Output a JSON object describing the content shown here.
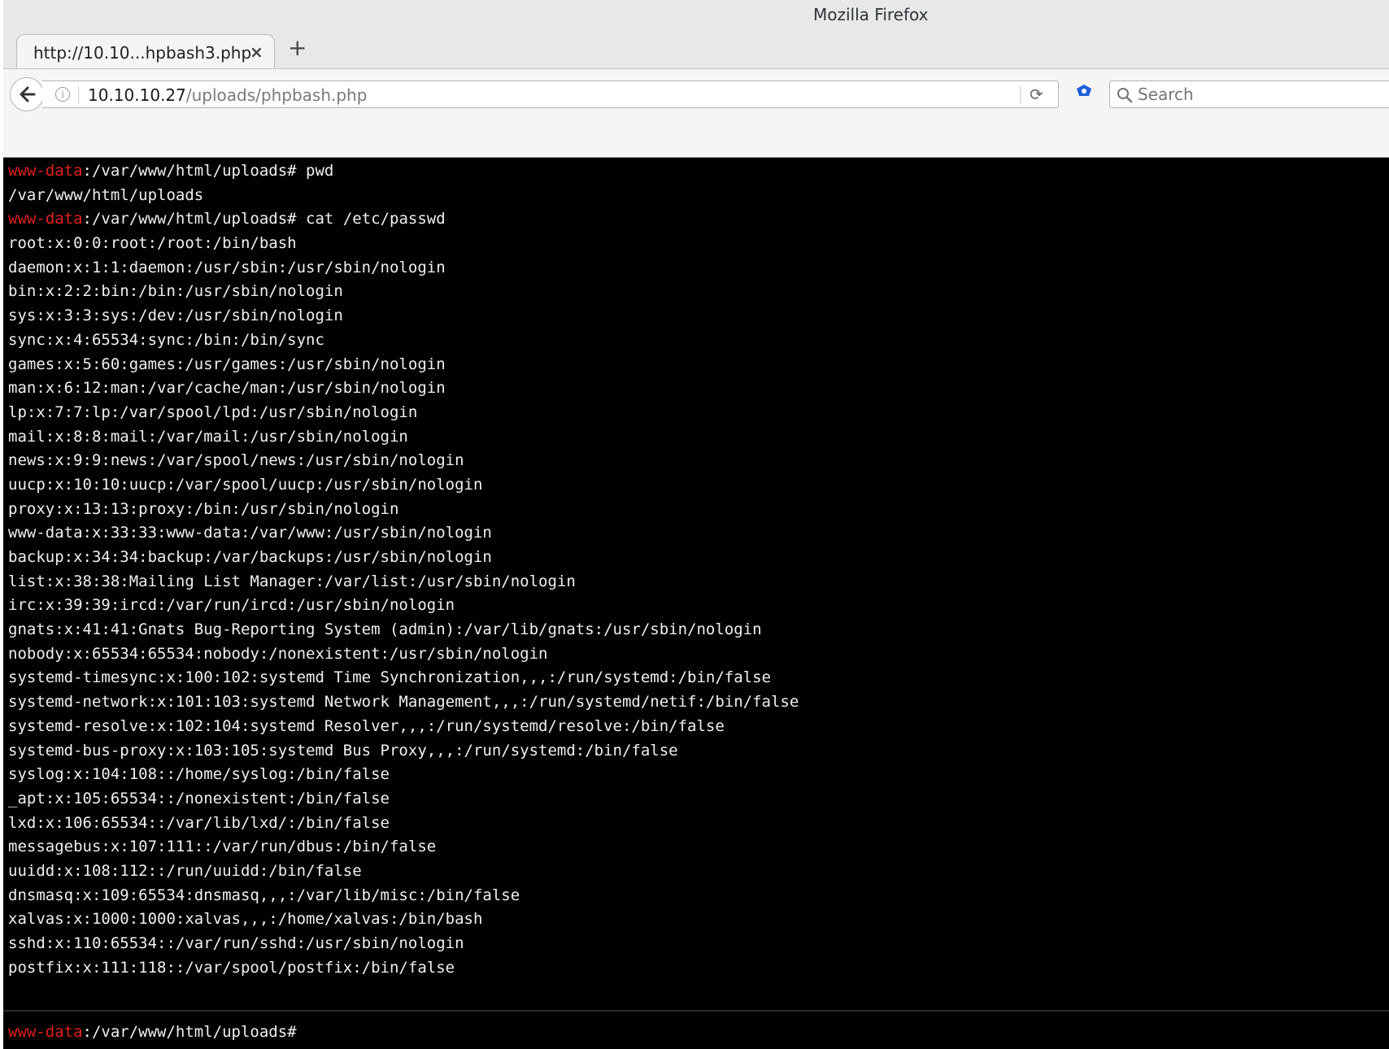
{
  "window": {
    "title": "Mozilla Firefox"
  },
  "tabs": [
    {
      "label": "http://10.10...hpbash3.php",
      "close_glyph": "×"
    }
  ],
  "new_tab_glyph": "+",
  "urlbar": {
    "host": "10.10.10.27",
    "path": "/uploads/phpbash.php"
  },
  "search": {
    "placeholder": "Search"
  },
  "colors": {
    "prompt_user": "#e02020",
    "terminal_bg": "#000000",
    "terminal_fg": "#f0f0f0"
  },
  "terminal": {
    "prompt_user": "www-data",
    "prompt_path": ":/var/www/html/uploads#",
    "lines": [
      {
        "user": "www-data",
        "text": ":/var/www/html/uploads# pwd"
      },
      {
        "text": "/var/www/html/uploads"
      },
      {
        "user": "www-data",
        "text": ":/var/www/html/uploads# cat /etc/passwd"
      },
      {
        "text": "root:x:0:0:root:/root:/bin/bash"
      },
      {
        "text": "daemon:x:1:1:daemon:/usr/sbin:/usr/sbin/nologin"
      },
      {
        "text": "bin:x:2:2:bin:/bin:/usr/sbin/nologin"
      },
      {
        "text": "sys:x:3:3:sys:/dev:/usr/sbin/nologin"
      },
      {
        "text": "sync:x:4:65534:sync:/bin:/bin/sync"
      },
      {
        "text": "games:x:5:60:games:/usr/games:/usr/sbin/nologin"
      },
      {
        "text": "man:x:6:12:man:/var/cache/man:/usr/sbin/nologin"
      },
      {
        "text": "lp:x:7:7:lp:/var/spool/lpd:/usr/sbin/nologin"
      },
      {
        "text": "mail:x:8:8:mail:/var/mail:/usr/sbin/nologin"
      },
      {
        "text": "news:x:9:9:news:/var/spool/news:/usr/sbin/nologin"
      },
      {
        "text": "uucp:x:10:10:uucp:/var/spool/uucp:/usr/sbin/nologin"
      },
      {
        "text": "proxy:x:13:13:proxy:/bin:/usr/sbin/nologin"
      },
      {
        "text": "www-data:x:33:33:www-data:/var/www:/usr/sbin/nologin"
      },
      {
        "text": "backup:x:34:34:backup:/var/backups:/usr/sbin/nologin"
      },
      {
        "text": "list:x:38:38:Mailing List Manager:/var/list:/usr/sbin/nologin"
      },
      {
        "text": "irc:x:39:39:ircd:/var/run/ircd:/usr/sbin/nologin"
      },
      {
        "text": "gnats:x:41:41:Gnats Bug-Reporting System (admin):/var/lib/gnats:/usr/sbin/nologin"
      },
      {
        "text": "nobody:x:65534:65534:nobody:/nonexistent:/usr/sbin/nologin"
      },
      {
        "text": "systemd-timesync:x:100:102:systemd Time Synchronization,,,:/run/systemd:/bin/false"
      },
      {
        "text": "systemd-network:x:101:103:systemd Network Management,,,:/run/systemd/netif:/bin/false"
      },
      {
        "text": "systemd-resolve:x:102:104:systemd Resolver,,,:/run/systemd/resolve:/bin/false"
      },
      {
        "text": "systemd-bus-proxy:x:103:105:systemd Bus Proxy,,,:/run/systemd:/bin/false"
      },
      {
        "text": "syslog:x:104:108::/home/syslog:/bin/false"
      },
      {
        "text": "_apt:x:105:65534::/nonexistent:/bin/false"
      },
      {
        "text": "lxd:x:106:65534::/var/lib/lxd/:/bin/false"
      },
      {
        "text": "messagebus:x:107:111::/var/run/dbus:/bin/false"
      },
      {
        "text": "uuidd:x:108:112::/run/uuidd:/bin/false"
      },
      {
        "text": "dnsmasq:x:109:65534:dnsmasq,,,:/var/lib/misc:/bin/false"
      },
      {
        "text": "xalvas:x:1000:1000:xalvas,,,:/home/xalvas:/bin/bash"
      },
      {
        "text": "sshd:x:110:65534::/var/run/sshd:/usr/sbin/nologin"
      },
      {
        "text": "postfix:x:111:118::/var/spool/postfix:/bin/false"
      }
    ],
    "input_value": ""
  }
}
